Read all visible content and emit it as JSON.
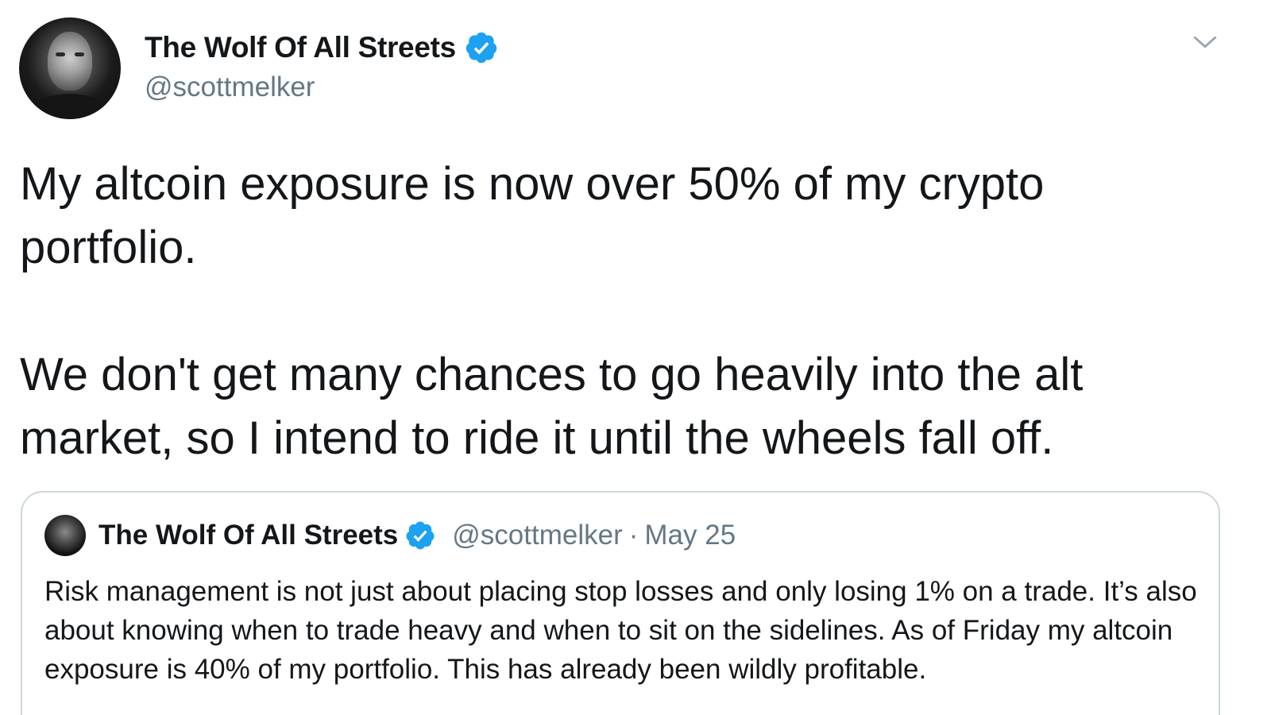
{
  "tweet": {
    "author": {
      "display_name": "The Wolf Of All Streets",
      "handle": "@scottmelker",
      "verified": true
    },
    "text_paragraphs": [
      "My altcoin exposure is now over 50% of my crypto portfolio.",
      "We don't get many chances to go heavily into the alt market, so I intend to ride it until the wheels fall off."
    ],
    "icons": {
      "verified": "verified-badge-icon",
      "menu": "chevron-down-icon"
    },
    "quoted_tweet": {
      "display_name": "The Wolf Of All Streets",
      "handle": "@scottmelker",
      "separator": "·",
      "date": "May 25",
      "text": "Risk management is not just about placing stop losses and only losing 1% on a trade. It’s also about knowing when to trade heavy and when to sit on the sidelines. As of Friday my altcoin exposure is 40% of my portfolio. This has already been wildly profitable."
    }
  },
  "colors": {
    "verified_blue": "#1da1f2",
    "secondary_text": "#657786",
    "border": "#ccd6dd",
    "primary_text": "#14171a"
  }
}
